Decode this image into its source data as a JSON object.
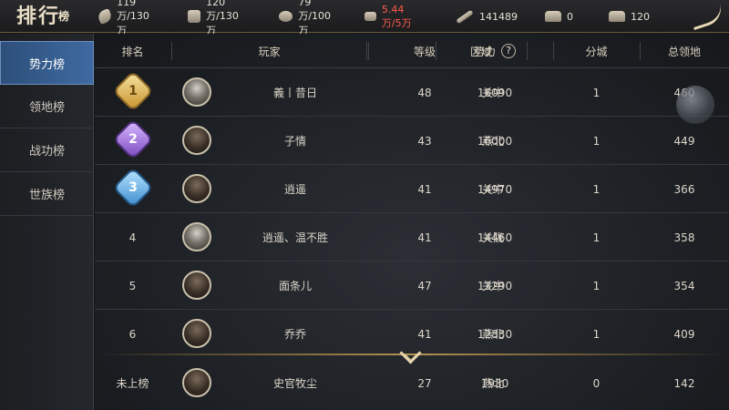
{
  "header": {
    "title_main": "排行",
    "title_small": "榜",
    "resources": [
      {
        "icon": "wheat-icon",
        "value": "119万/130万"
      },
      {
        "icon": "wood-icon",
        "value": "120万/130万"
      },
      {
        "icon": "stone-icon",
        "value": "79万/100万"
      },
      {
        "icon": "iron-icon",
        "value": "5.44万/5万",
        "color": "#ff5b4d"
      },
      {
        "icon": "sword-icon",
        "value": "141489"
      },
      {
        "icon": "silver-icon",
        "value": "0"
      },
      {
        "icon": "gold-icon",
        "value": "120"
      }
    ]
  },
  "sidebar": {
    "items": [
      {
        "label": "势力榜",
        "active": true
      },
      {
        "label": "领地榜"
      },
      {
        "label": "战功榜"
      },
      {
        "label": "世族榜"
      }
    ]
  },
  "table": {
    "headers": [
      "排名",
      "玩家",
      "等级",
      "区域",
      "势力",
      "分城",
      "总领地"
    ],
    "rows": [
      {
        "rank": "1",
        "player": "義丨昔日",
        "level": "48",
        "region": "关中",
        "power": "16090",
        "branch_city": "1",
        "territory": "460"
      },
      {
        "rank": "2",
        "player": "子情",
        "level": "43",
        "region": "燕北",
        "power": "16000",
        "branch_city": "1",
        "territory": "449"
      },
      {
        "rank": "3",
        "player": "逍遥",
        "level": "41",
        "region": "关中",
        "power": "14970",
        "branch_city": "1",
        "territory": "366"
      },
      {
        "rank": "4",
        "player": "逍遥、温不胜",
        "level": "41",
        "region": "关陇",
        "power": "14460",
        "branch_city": "1",
        "territory": "358"
      },
      {
        "rank": "5",
        "player": "面条儿",
        "level": "47",
        "region": "关中",
        "power": "13290",
        "branch_city": "1",
        "territory": "354"
      },
      {
        "rank": "6",
        "player": "乔乔",
        "level": "41",
        "region": "燕北",
        "power": "12830",
        "branch_city": "1",
        "territory": "409"
      }
    ],
    "self": {
      "rank": "未上榜",
      "player": "史官牧尘",
      "level": "27",
      "region": "燕北",
      "power": "1930",
      "branch_city": "0",
      "territory": "142"
    }
  }
}
